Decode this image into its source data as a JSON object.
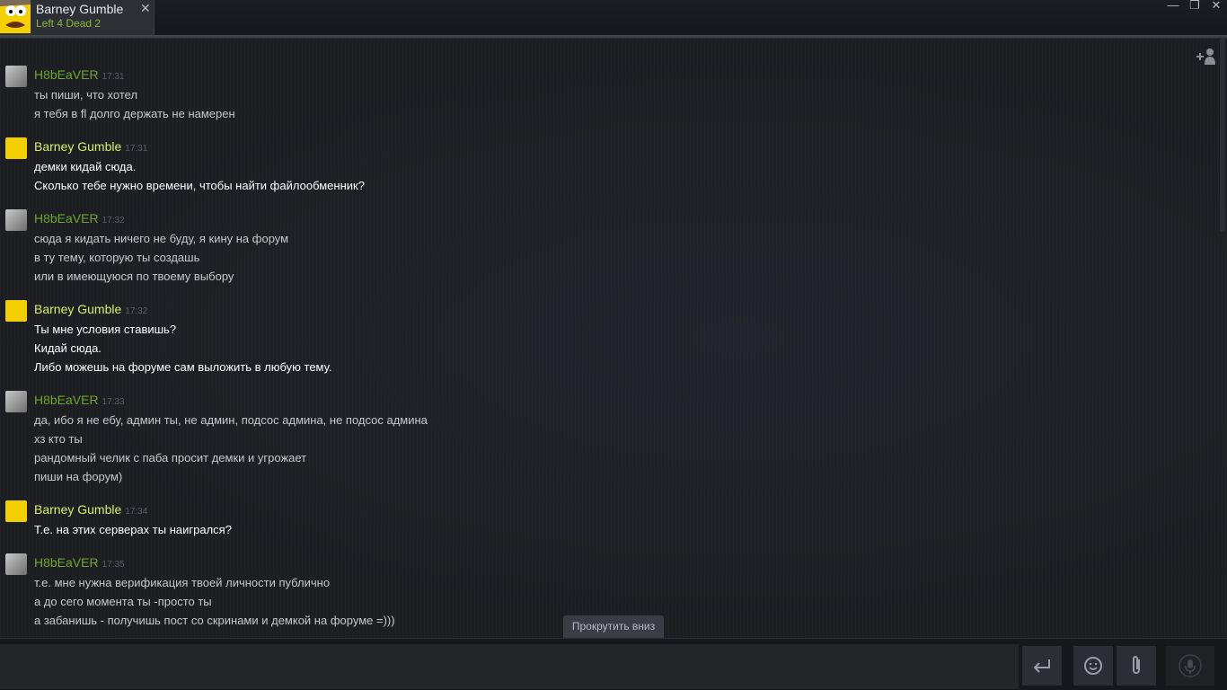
{
  "tab": {
    "name": "Barney Gumble",
    "game": "Left 4 Dead 2",
    "close": "✕"
  },
  "window": {
    "minimize": "—",
    "maximize": "❐",
    "close": "✕"
  },
  "scroll_down_label": "Прокрутить вниз",
  "messages": [
    {
      "sender": "H8bEaVER",
      "time": "17:31",
      "lines": [
        "ты пиши, что хотел",
        "я тебя в fl долго держать не намерен"
      ]
    },
    {
      "sender": "Barney Gumble",
      "time": "17:31",
      "lines": [
        "демки кидай сюда.",
        "Сколько тебе нужно времени, чтобы найти файлообменник?"
      ]
    },
    {
      "sender": "H8bEaVER",
      "time": "17:32",
      "lines": [
        "сюда я кидать ничего не буду, я кину на форум",
        "в ту тему, которую ты создашь",
        "или в имеющуюся по твоему выбору"
      ]
    },
    {
      "sender": "Barney Gumble",
      "time": "17:32",
      "lines": [
        "Ты мне условия ставишь?",
        "Кидай сюда.",
        "Либо можешь на форуме сам выложить в любую тему."
      ]
    },
    {
      "sender": "H8bEaVER",
      "time": "17:33",
      "lines": [
        "да, ибо я не ебу, админ ты, не админ, подсос админа, не подсос админа",
        "хз кто ты",
        "рандомный челик с паба просит демки и угрожает",
        "пиши на форум)"
      ]
    },
    {
      "sender": "Barney Gumble",
      "time": "17:34",
      "lines": [
        "Т.е. на этих серверах ты наигрался?"
      ]
    },
    {
      "sender": "H8bEaVER",
      "time": "17:35",
      "lines": [
        "т.е. мне нужна верификация твоей личности публично",
        "а до сего момента ты -просто ты",
        "а забанишь - получишь пост со скринами и демкой на форуме =)))"
      ]
    }
  ],
  "input": {
    "value": "",
    "placeholder": ""
  },
  "icons": {
    "send": "enter-icon",
    "emoji": "smiley-icon",
    "attach": "paperclip-icon",
    "mic": "microphone-icon",
    "add_friend": "add-friend-icon"
  },
  "colors": {
    "h8_name": "#6fa52f",
    "barney_name": "#d7f06a",
    "game": "#8db739",
    "background": "#1e2024"
  }
}
